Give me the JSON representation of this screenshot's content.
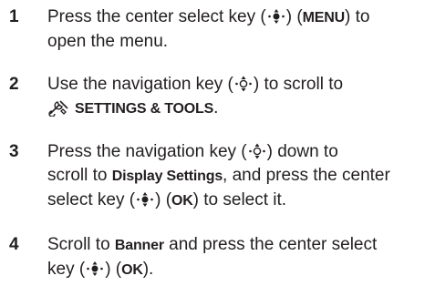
{
  "steps": [
    {
      "number": "1",
      "line1_pre": "Press the center select key (",
      "line1_post": ") (",
      "key_label": "MENU",
      "line1_end": ") to",
      "line2": "open the menu."
    },
    {
      "number": "2",
      "line1_pre": "Use the navigation key (",
      "line1_post": ") to scroll to",
      "line2_label": "SETTINGS & TOOLS",
      "line2_end": "."
    },
    {
      "number": "3",
      "line1_pre": "Press the navigation key (",
      "line1_post": ") down to",
      "line2_pre": "scroll to ",
      "line2_label": "Display Settings",
      "line2_post": ", and press the center",
      "line3_pre": "select key (",
      "line3_mid": ") (",
      "key_label": "OK",
      "line3_end": ") to select it."
    },
    {
      "number": "4",
      "line1_pre": "Scroll to ",
      "line1_label": "Banner",
      "line1_post": " and press the center select",
      "line2_pre": "key (",
      "line2_mid": ") (",
      "key_label": "OK",
      "line2_end": ")."
    }
  ],
  "icons": {
    "center_select_key": "center-select-key-icon",
    "navigation_key": "navigation-key-icon",
    "settings_tools": "settings-tools-icon"
  }
}
